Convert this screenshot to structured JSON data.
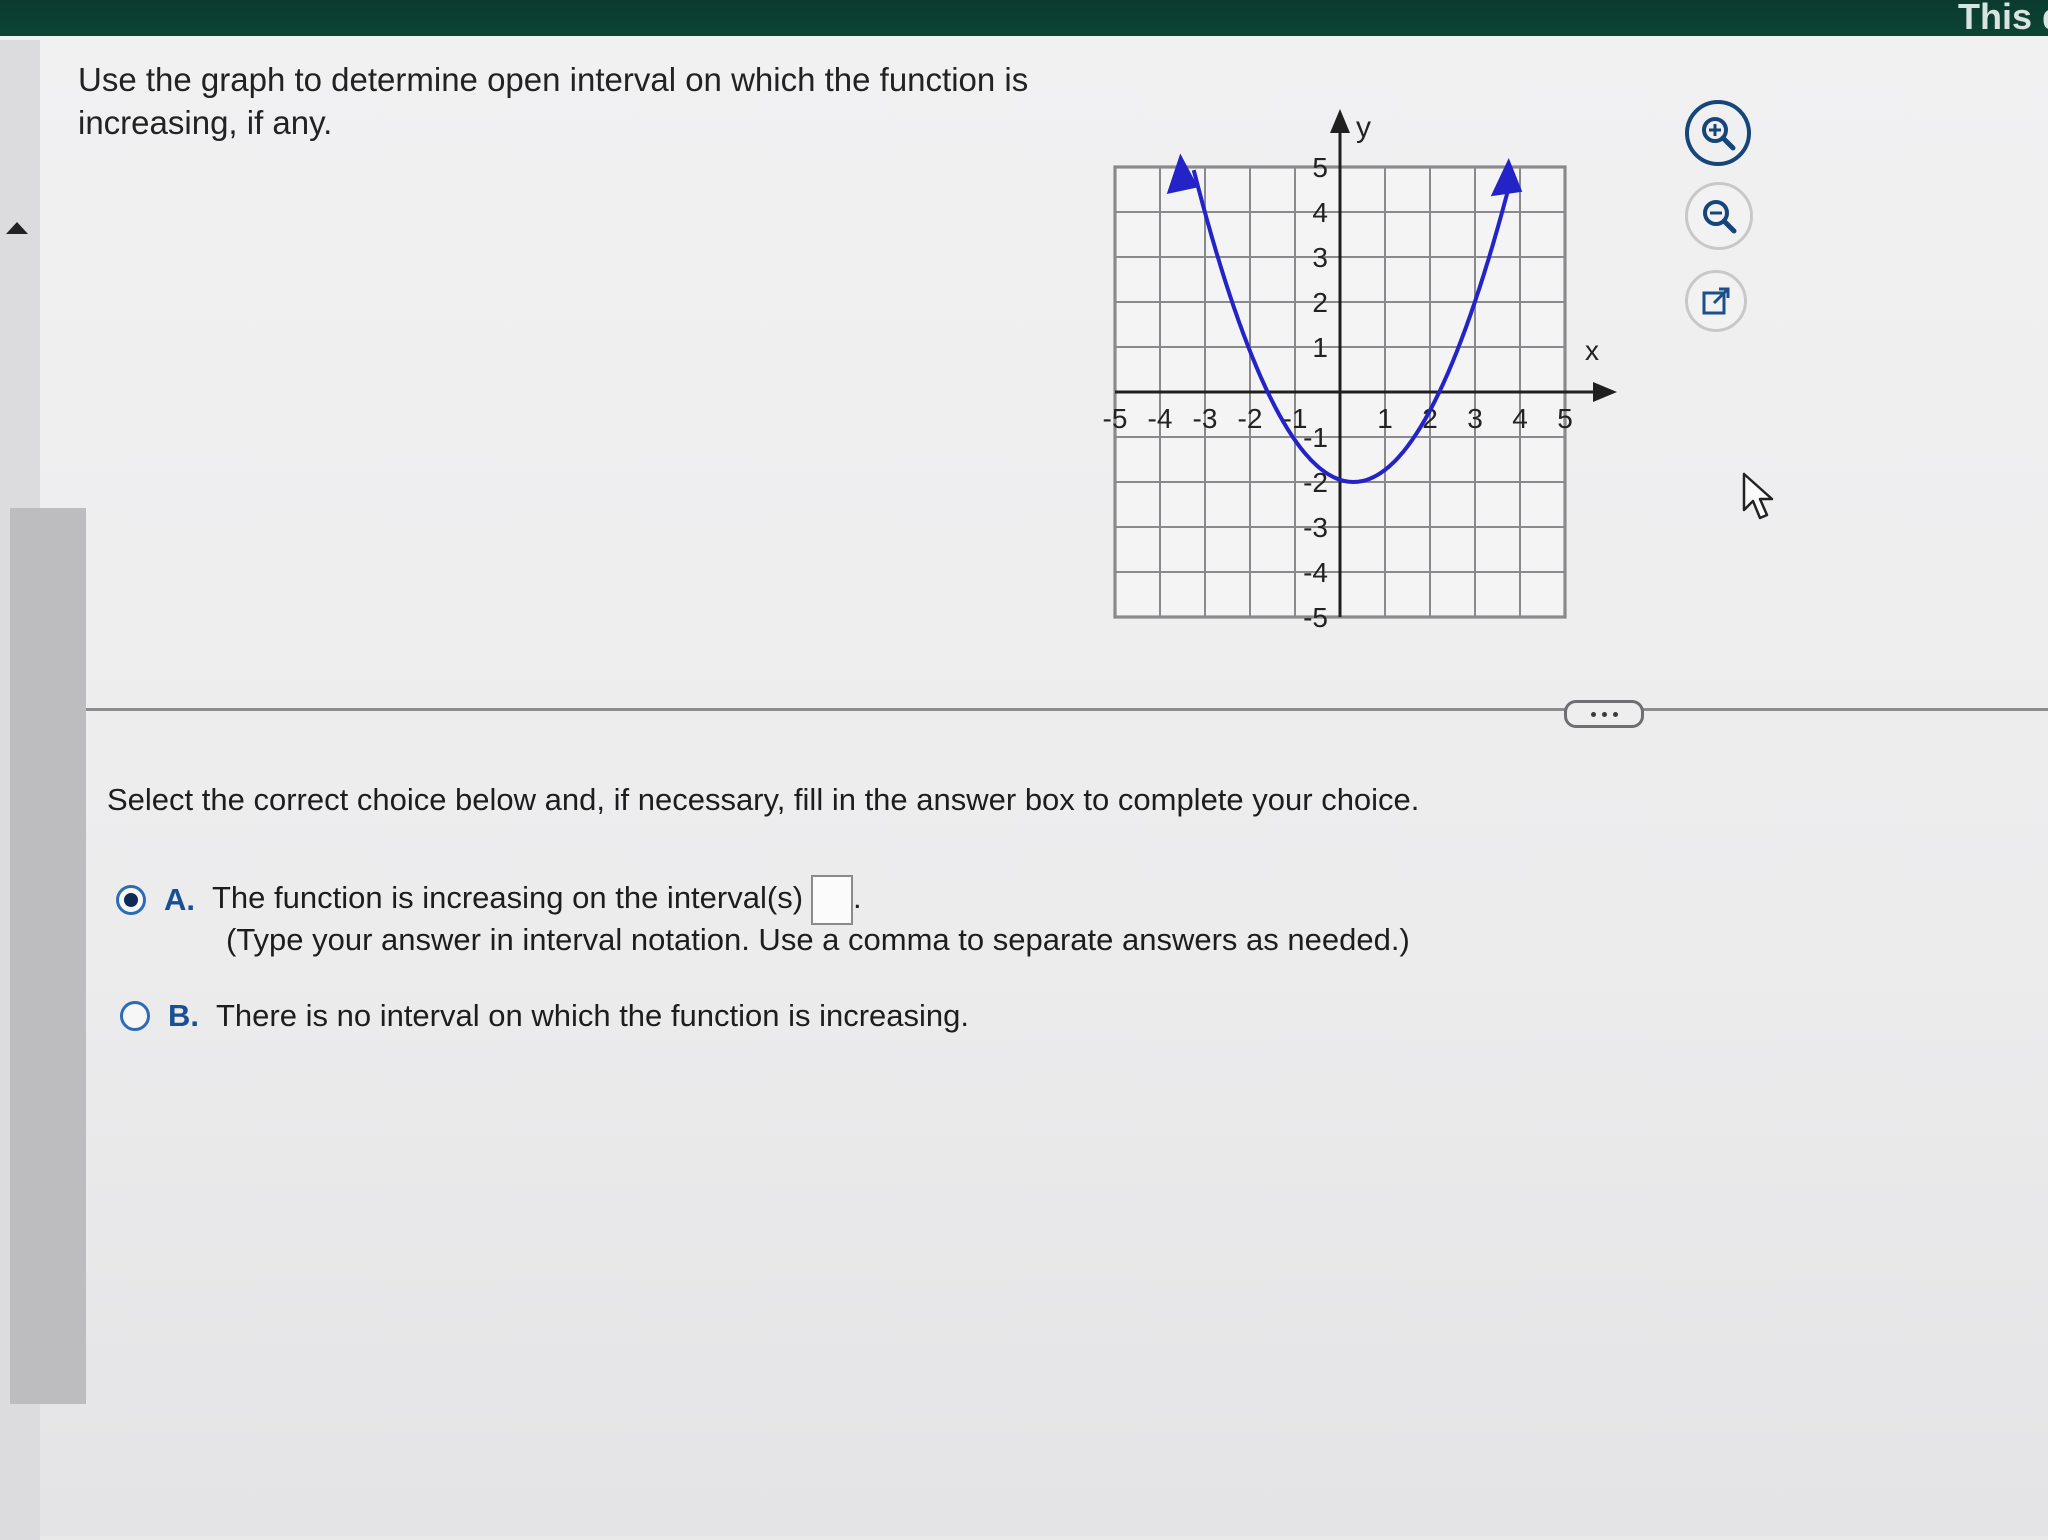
{
  "header": {
    "corner_text": "This q"
  },
  "question": {
    "text": "Use the graph to determine open interval on which the function is increasing, if any."
  },
  "graph": {
    "x_label": "x",
    "y_label": "y",
    "x_ticks": [
      "-5",
      "-4",
      "-3",
      "-2",
      "-1",
      "1",
      "2",
      "3",
      "4",
      "5"
    ],
    "y_ticks": [
      "5",
      "4",
      "3",
      "2",
      "1",
      "-1",
      "-2",
      "-3",
      "-4",
      "-5"
    ],
    "curve_color": "#2323c8"
  },
  "tools": {
    "zoom_in": "zoom-in-icon",
    "zoom_out": "zoom-out-icon",
    "popout": "popout-icon"
  },
  "instruction": "Select the correct choice below and, if necessary, fill in the answer box to complete your choice.",
  "choices": [
    {
      "letter": "A.",
      "text": "The function is increasing on the interval(s)",
      "suffix": ".",
      "selected": true
    },
    {
      "letter": "B.",
      "text": "There is no interval on which the function is increasing.",
      "selected": false
    }
  ],
  "hint": "(Type your answer in interval notation. Use a comma to separate answers as needed.)",
  "answer": {
    "value": ""
  }
}
